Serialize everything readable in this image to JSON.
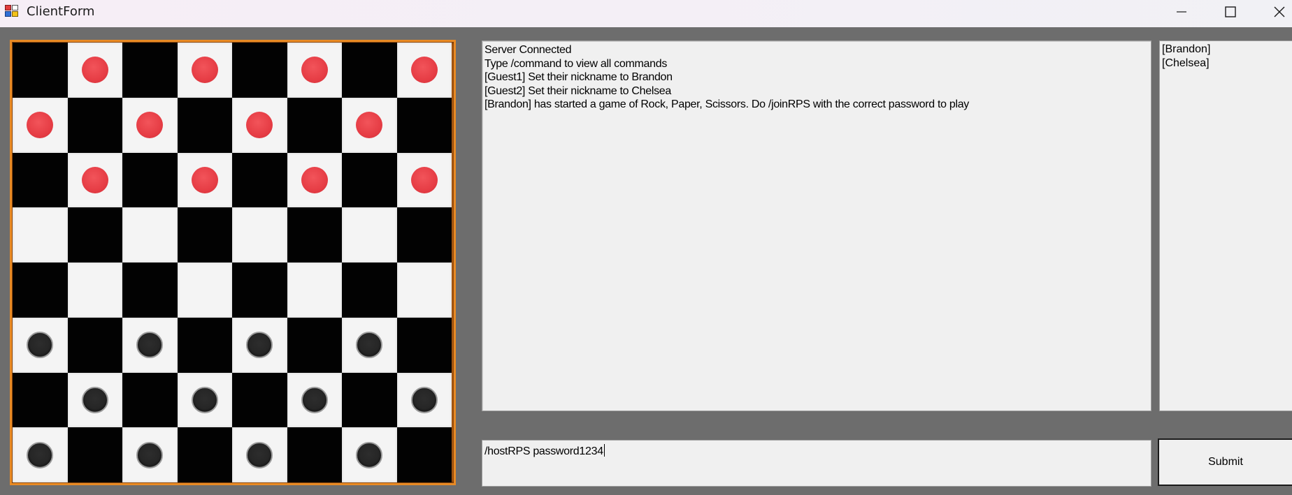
{
  "window": {
    "title": "ClientForm"
  },
  "board": {
    "rows": [
      [
        "",
        "red",
        "",
        "red",
        "",
        "red",
        "",
        "red"
      ],
      [
        "red",
        "",
        "red",
        "",
        "red",
        "",
        "red",
        ""
      ],
      [
        "",
        "red",
        "",
        "red",
        "",
        "red",
        "",
        "red"
      ],
      [
        "",
        "",
        "",
        "",
        "",
        "",
        "",
        ""
      ],
      [
        "",
        "",
        "",
        "",
        "",
        "",
        "",
        ""
      ],
      [
        "black",
        "",
        "black",
        "",
        "black",
        "",
        "black",
        ""
      ],
      [
        "",
        "black",
        "",
        "black",
        "",
        "black",
        "",
        "black"
      ],
      [
        "black",
        "",
        "black",
        "",
        "black",
        "",
        "black",
        ""
      ]
    ]
  },
  "chat": {
    "lines": [
      "Server Connected",
      "Type /command to view all commands",
      "[Guest1] Set their nickname to Brandon",
      "[Guest2] Set their nickname to Chelsea",
      "[Brandon] has started a game of Rock, Paper, Scissors. Do /joinRPS with the correct password to play"
    ]
  },
  "users": [
    "[Brandon]",
    "[Chelsea]"
  ],
  "input": {
    "value": "/hostRPS password1234"
  },
  "submit": {
    "label": "Submit"
  }
}
